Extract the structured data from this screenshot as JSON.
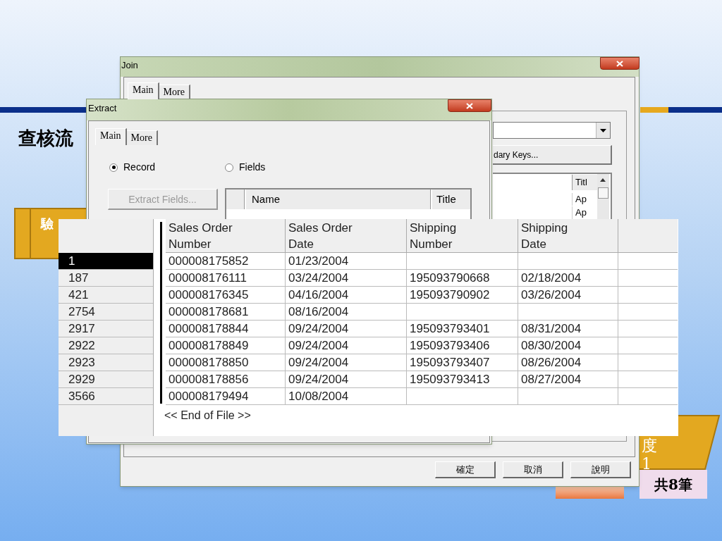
{
  "slide": {
    "subtitle": "查核流",
    "left_box_label": "驗",
    "right_box_lines": [
      "度",
      "1"
    ],
    "count_badge": "共8筆"
  },
  "join_window": {
    "title": "Join",
    "tabs": [
      {
        "label": "Main",
        "selected": true
      },
      {
        "label": "More",
        "selected": false
      }
    ],
    "keys_button": "dary Keys...",
    "grid": {
      "header": "Titl",
      "cells": [
        "Ap",
        "Ap"
      ]
    },
    "buttons": [
      "確定",
      "取消",
      "說明"
    ]
  },
  "extract_window": {
    "title": "Extract",
    "tabs": [
      {
        "label": "Main",
        "selected": true
      },
      {
        "label": "More",
        "selected": false
      }
    ],
    "radios": [
      {
        "label": "Record",
        "selected": true
      },
      {
        "label": "Fields",
        "selected": false
      }
    ],
    "extract_fields_button": {
      "label": "Extract Fields...",
      "disabled": true
    },
    "grid": {
      "columns": [
        "Name",
        "Title"
      ]
    }
  },
  "results": {
    "columns": [
      "Sales Order Number",
      "Sales Order Date",
      "Shipping Number",
      "Shipping Date"
    ],
    "rows": [
      {
        "record": "1",
        "selected": true,
        "cells": [
          "000008175852",
          "01/23/2004"
        ]
      },
      {
        "record": "187",
        "selected": false,
        "cells": [
          "000008176111",
          "03/24/2004",
          "195093790668",
          "02/18/2004"
        ]
      },
      {
        "record": "421",
        "selected": false,
        "cells": [
          "000008176345",
          "04/16/2004",
          "195093790902",
          "03/26/2004"
        ]
      },
      {
        "record": "2754",
        "selected": false,
        "cells": [
          "000008178681",
          "08/16/2004"
        ]
      },
      {
        "record": "2917",
        "selected": false,
        "cells": [
          "000008178844",
          "09/24/2004",
          "195093793401",
          "08/31/2004"
        ]
      },
      {
        "record": "2922",
        "selected": false,
        "cells": [
          "000008178849",
          "09/24/2004",
          "195093793406",
          "08/30/2004"
        ]
      },
      {
        "record": "2923",
        "selected": false,
        "cells": [
          "000008178850",
          "09/24/2004",
          "195093793407",
          "08/26/2004"
        ]
      },
      {
        "record": "2929",
        "selected": false,
        "cells": [
          "000008178856",
          "09/24/2004",
          "195093793413",
          "08/27/2004"
        ]
      },
      {
        "record": "3566",
        "selected": false,
        "cells": [
          "000008179494",
          "10/08/2004"
        ]
      }
    ],
    "footer": "<< End of File >>"
  }
}
